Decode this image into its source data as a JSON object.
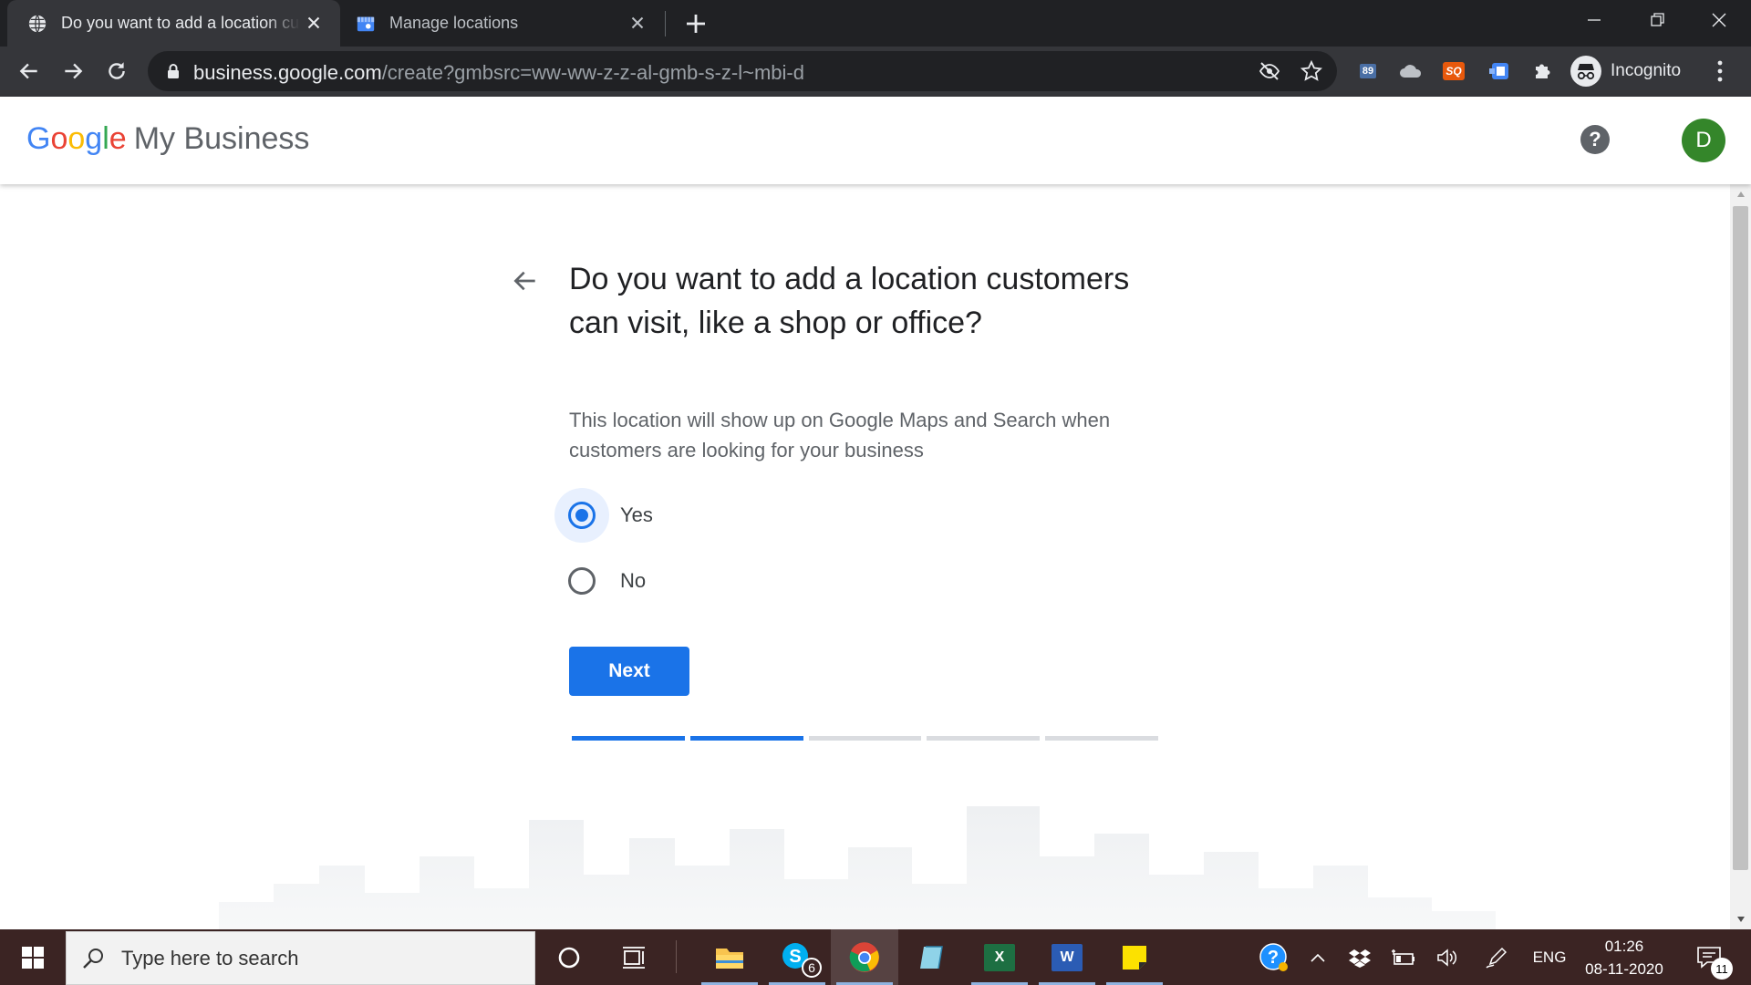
{
  "browser": {
    "tabs": [
      {
        "title": "Do you want to add a location customers can visit",
        "active": true,
        "favicon": "globe-icon"
      },
      {
        "title": "Manage locations",
        "active": false,
        "favicon": "google-my-business-icon"
      }
    ],
    "address_bar": {
      "host": "business.google.com",
      "path": "/create?gmbsrc=ww-ww-z-z-al-gmb-s-z-l~mbi-d"
    },
    "extensions": [
      {
        "name": "badge-89-extension",
        "label": "89",
        "color": "#4a6fa5"
      },
      {
        "name": "cloud-extension",
        "label": "",
        "color": ""
      },
      {
        "name": "seoquake-extension",
        "label": "SQ",
        "color": "#e8590c"
      },
      {
        "name": "blue-extension",
        "label": "",
        "color": "#4285f4"
      },
      {
        "name": "puzzle-extensions-icon",
        "label": "",
        "color": ""
      }
    ],
    "profile_label": "Incognito"
  },
  "gmb": {
    "logo_letters": [
      "G",
      "o",
      "o",
      "g",
      "l",
      "e"
    ],
    "logo_suffix": "My Business",
    "help_label": "?",
    "avatar_initial": "D",
    "avatar_color": "#34862a"
  },
  "page": {
    "question": "Do you want to add a location customers can visit, like a shop or office?",
    "description": "This location will show up on Google Maps and Search when customers are looking for your business",
    "options": [
      {
        "label": "Yes",
        "selected": true
      },
      {
        "label": "No",
        "selected": false
      }
    ],
    "next_label": "Next",
    "progress": {
      "total_steps": 5,
      "completed_steps": 2
    },
    "accent_color": "#1a73e8"
  },
  "taskbar": {
    "search_placeholder": "Type here to search",
    "skype_badge": "6",
    "excel_label": "X",
    "word_label": "W",
    "language": "ENG",
    "time": "01:26",
    "date": "08-11-2020",
    "notification_count": "11"
  }
}
